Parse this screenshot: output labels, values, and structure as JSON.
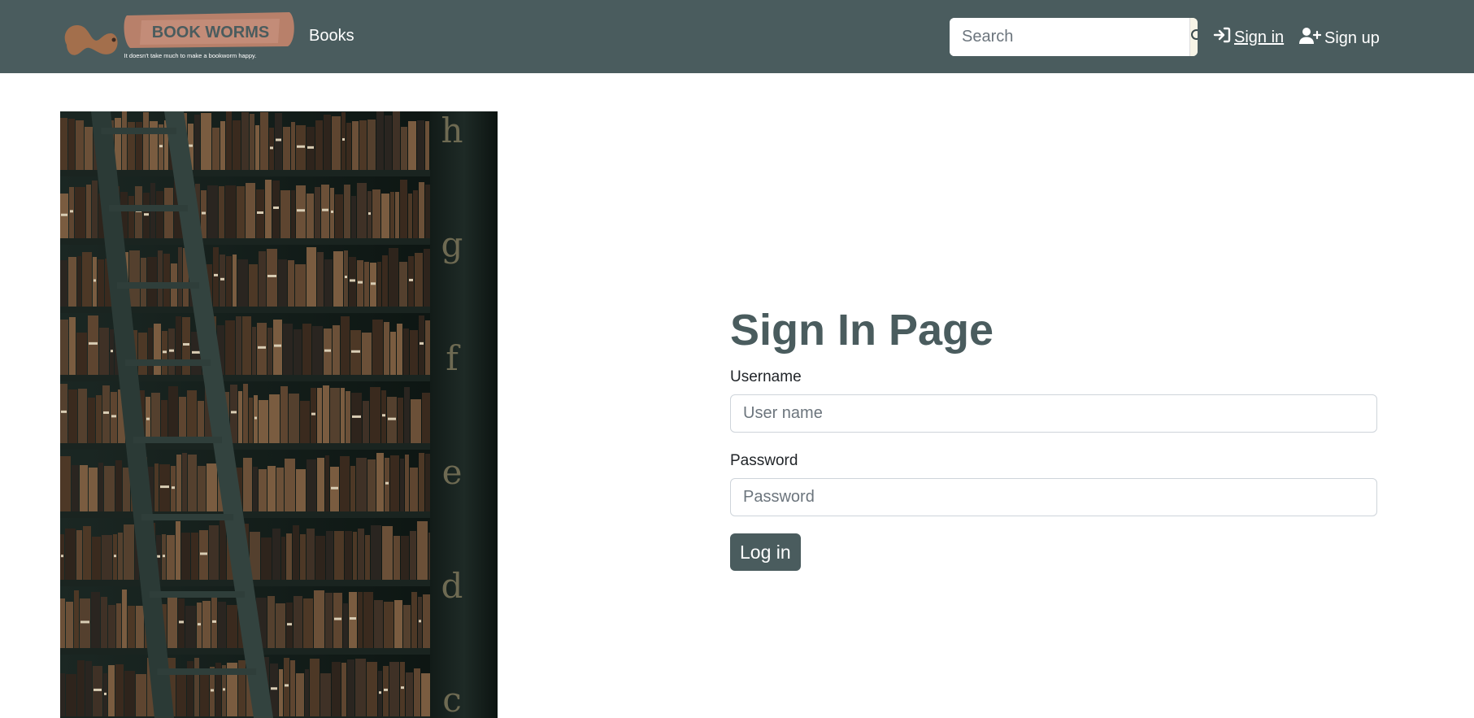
{
  "navbar": {
    "logo": {
      "title": "BOOK WORMS",
      "tagline": "It doesn't take much to make a bookworm happy."
    },
    "books_link": "Books",
    "search": {
      "placeholder": "Search",
      "icon": "search-icon"
    },
    "signin": {
      "label": " Sign in",
      "icon": "sign-in-icon"
    },
    "signup": {
      "label": "Sign up",
      "icon": "user-plus-icon"
    }
  },
  "hero": {
    "image": "library-bookshelves-with-ladder",
    "shelf_letters": [
      "h",
      "g",
      "f",
      "e",
      "d",
      "c"
    ]
  },
  "form": {
    "title": "Sign In Page",
    "username_label": "Username",
    "username_placeholder": "User name",
    "password_label": "Password",
    "password_placeholder": "Password",
    "login_button": "Log in"
  },
  "colors": {
    "navbar": "#4a5c5e",
    "accent": "#4a5c5e",
    "logo_copper": "#b07a58"
  }
}
